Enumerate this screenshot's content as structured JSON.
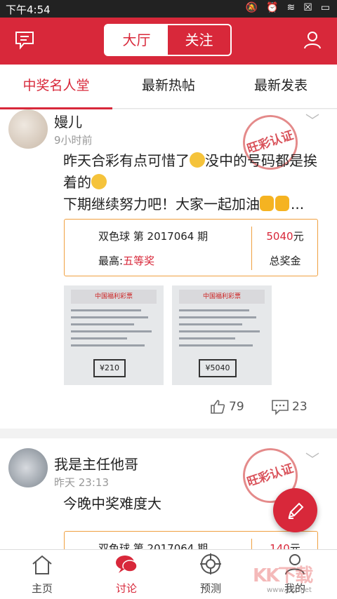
{
  "status": {
    "time": "下午4:54"
  },
  "header": {
    "tab_hall": "大厅",
    "tab_follow": "关注"
  },
  "tabs": [
    {
      "label": "中奖名人堂",
      "active": true
    },
    {
      "label": "最新热帖",
      "active": false
    },
    {
      "label": "最新发表",
      "active": false
    }
  ],
  "posts": [
    {
      "username": "嫚儿",
      "time": "9小时前",
      "stamp": "旺彩认证",
      "text_line1": "昨天合彩有点可惜了",
      "text_line1b": "没中的号码都是挨",
      "text_line2": "着的",
      "text_line3": "下期继续努力吧！大家一起加油",
      "text_line3_end": "...",
      "lottery": "双色球 第 2017064 期",
      "tier_label": "最高:",
      "tier_value": "五等奖",
      "amount": "5040",
      "amount_unit": "元",
      "total_label": "总奖金",
      "ticket1_brand": "中国福利彩票",
      "ticket1_stamp": "¥210",
      "ticket2_brand": "中国福利彩票",
      "ticket2_stamp": "¥5040",
      "likes": "79",
      "comments": "23"
    },
    {
      "username": "我是主任他哥",
      "time": "昨天 23:13",
      "stamp": "旺彩认证",
      "text": "今晚中奖难度大",
      "lottery": "双色球 第 2017064 期",
      "amount": "140",
      "amount_unit": "元"
    }
  ],
  "nav": [
    {
      "label": "主页",
      "icon": "home-icon"
    },
    {
      "label": "讨论",
      "icon": "chat-icon",
      "active": true
    },
    {
      "label": "预测",
      "icon": "target-icon"
    },
    {
      "label": "我的",
      "icon": "user-icon"
    }
  ],
  "watermark": "KK下载",
  "watermark_url": "www.kkx.net",
  "colors": {
    "brand": "#d8283a",
    "prize_border": "#f0a040"
  }
}
